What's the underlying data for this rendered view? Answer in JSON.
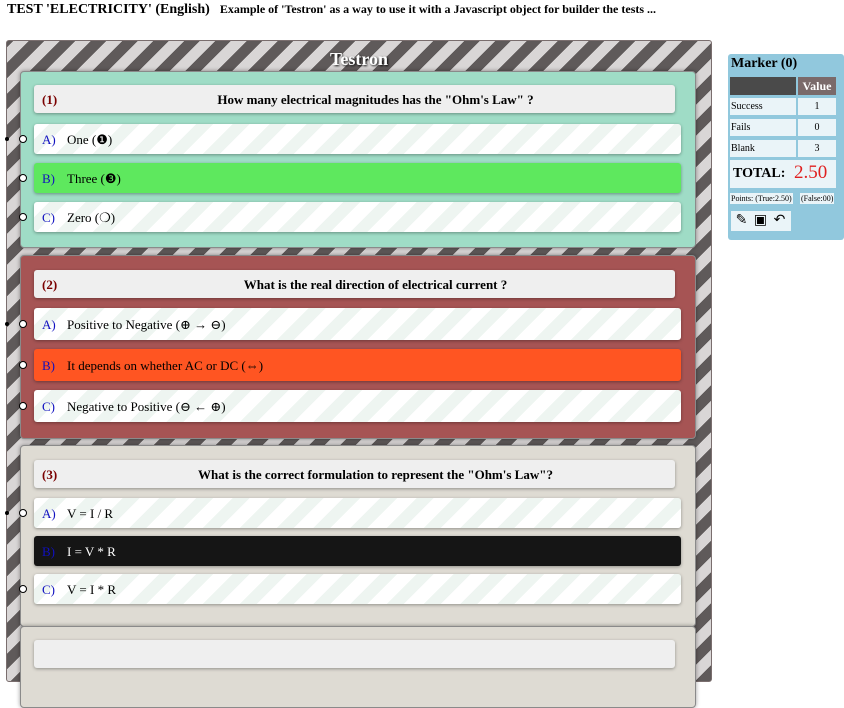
{
  "header": {
    "title": "TEST 'ELECTRICITY' (English)",
    "subtitle": "Example of 'Testron' as a way to use it with a Javascript object for builder the tests ..."
  },
  "testron": {
    "title": "Testron",
    "questions": [
      {
        "number": "(1)",
        "text": "How many electrical magnitudes has the \"Ohm's Law\" ?",
        "state": "correct",
        "state_color": "#9fdcc6",
        "options": [
          {
            "letter": "A)",
            "text": "One (❶)"
          },
          {
            "letter": "B)",
            "text": "Three (❸)",
            "selected": true,
            "selected_color": "#5ee85e"
          },
          {
            "letter": "C)",
            "text": "Zero (❍)"
          }
        ]
      },
      {
        "number": "(2)",
        "text": "What is the real direction of electrical current ?",
        "state": "wrong",
        "state_color": "#a65454",
        "options": [
          {
            "letter": "A)",
            "text": "Positive to Negative (⊕ → ⊖)"
          },
          {
            "letter": "B)",
            "text": "It depends on whether AC or DC (⇔)",
            "selected": true,
            "selected_color": "#ff5522"
          },
          {
            "letter": "C)",
            "text": "Negative to Positive (⊖ ← ⊕)"
          }
        ]
      },
      {
        "number": "(3)",
        "text": "What is the correct formulation to represent the \"Ohm's Law\"?",
        "state": "unanswered",
        "state_color": "#dedbd3",
        "options": [
          {
            "letter": "A)",
            "text": "V = I / R"
          },
          {
            "letter": "B)",
            "text": "I = V * R",
            "selected": true,
            "selected_color": "#151515"
          },
          {
            "letter": "C)",
            "text": "V = I * R"
          }
        ]
      }
    ]
  },
  "marker": {
    "title": "Marker (0)",
    "value_header": "Value",
    "rows": [
      {
        "label": "Success",
        "value": "1"
      },
      {
        "label": "Fails",
        "value": "0"
      },
      {
        "label": "Blank",
        "value": "3"
      }
    ],
    "total_label": "TOTAL:",
    "total_value": "2.50",
    "points_true": "Points: (True:2.50)",
    "points_false": "(False:00)",
    "buttons": [
      "edit-icon",
      "save-icon",
      "undo-icon"
    ]
  }
}
